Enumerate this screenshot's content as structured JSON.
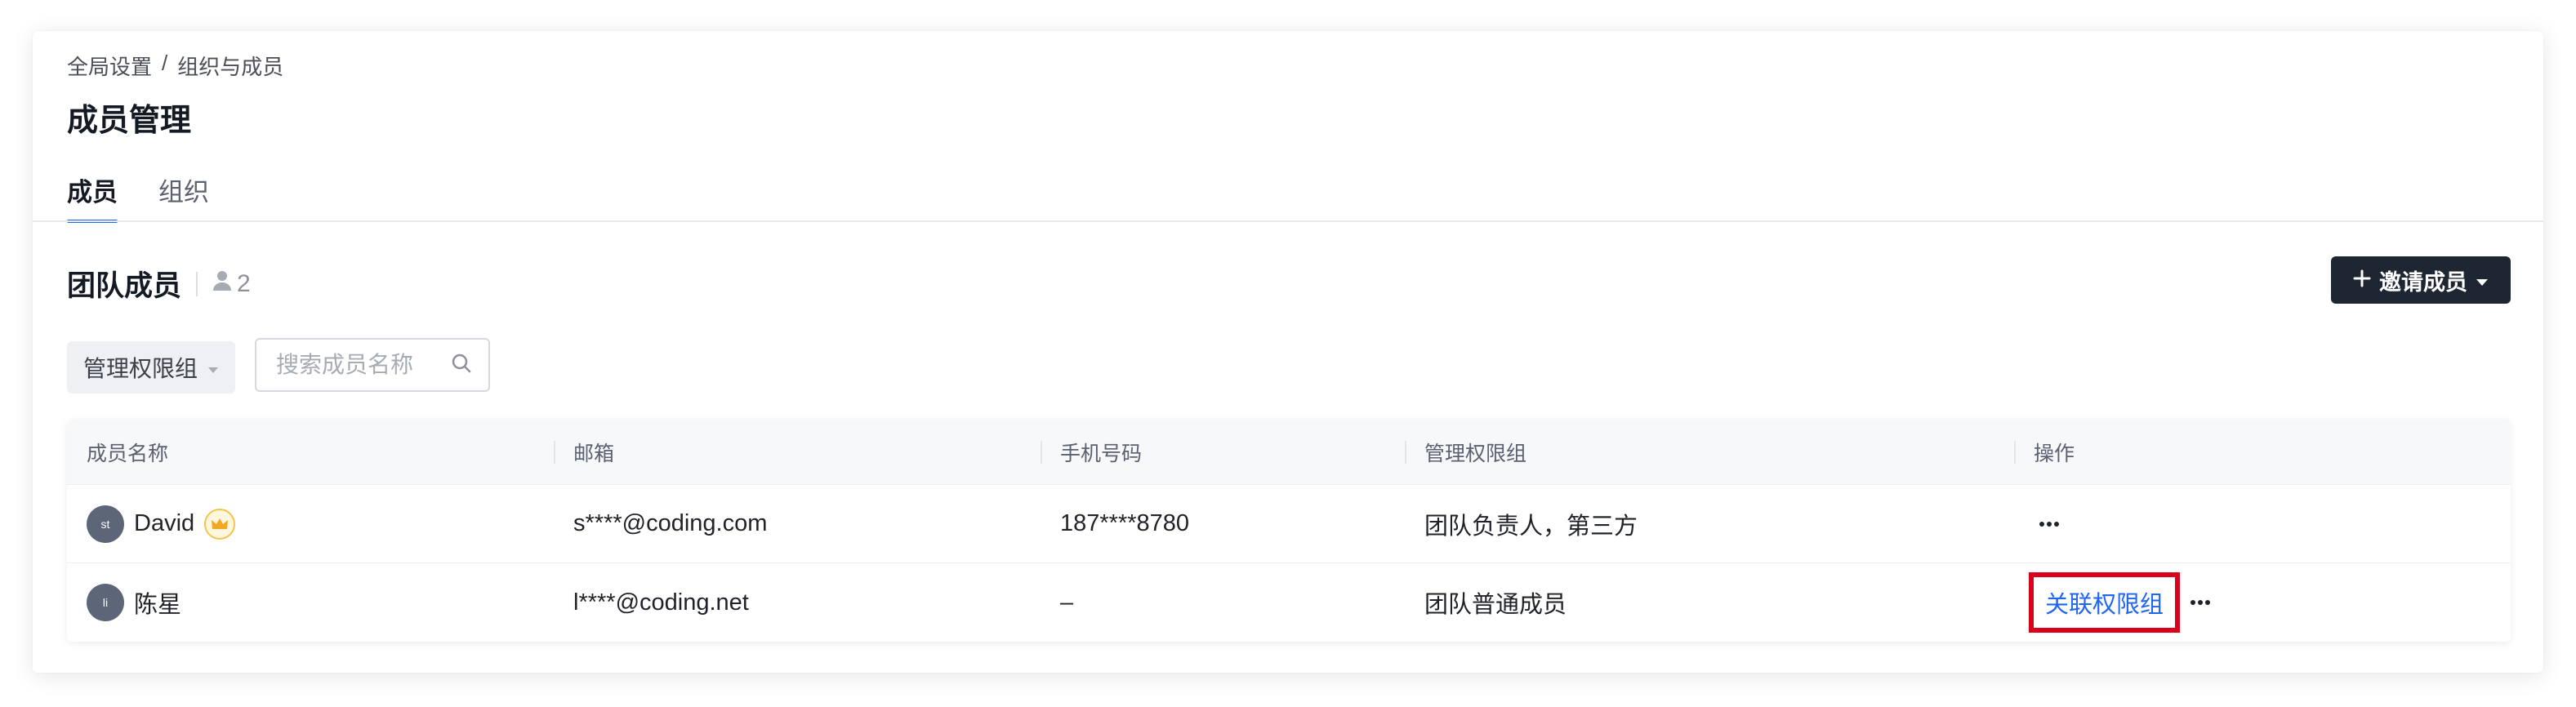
{
  "breadcrumb": {
    "root": "全局设置",
    "separator": "/",
    "current": "组织与成员"
  },
  "page": {
    "title": "成员管理"
  },
  "tabs": [
    {
      "label": "成员",
      "active": true
    },
    {
      "label": "组织",
      "active": false
    }
  ],
  "section": {
    "title": "团队成员",
    "member_count": "2"
  },
  "invite_button": {
    "label": "邀请成员"
  },
  "filter": {
    "label": "管理权限组"
  },
  "search": {
    "placeholder": "搜索成员名称",
    "value": ""
  },
  "table": {
    "columns": [
      "成员名称",
      "邮箱",
      "手机号码",
      "管理权限组",
      "操作"
    ],
    "rows": [
      {
        "avatar": "st",
        "name": "David",
        "owner_badge": true,
        "email": "s****@coding.com",
        "phone": "187****8780",
        "groups": "团队负责人，第三方",
        "action": ""
      },
      {
        "avatar": "li",
        "name": "陈星",
        "owner_badge": false,
        "email": "l****@coding.net",
        "phone": "–",
        "groups": "团队普通成员",
        "action": "关联权限组"
      }
    ]
  },
  "colors": {
    "accent": "#1f66f0",
    "highlight_border": "#d9001b",
    "invite_bg": "#1e2631",
    "avatar_bg": "#5d6678"
  },
  "icons": {
    "member_count": "user-icon",
    "invite": "plus-icon",
    "invite_caret": "caret-down-icon",
    "filter_caret": "caret-down-icon",
    "search": "search-icon",
    "owner": "crown-icon",
    "row_actions": "more-icon"
  }
}
